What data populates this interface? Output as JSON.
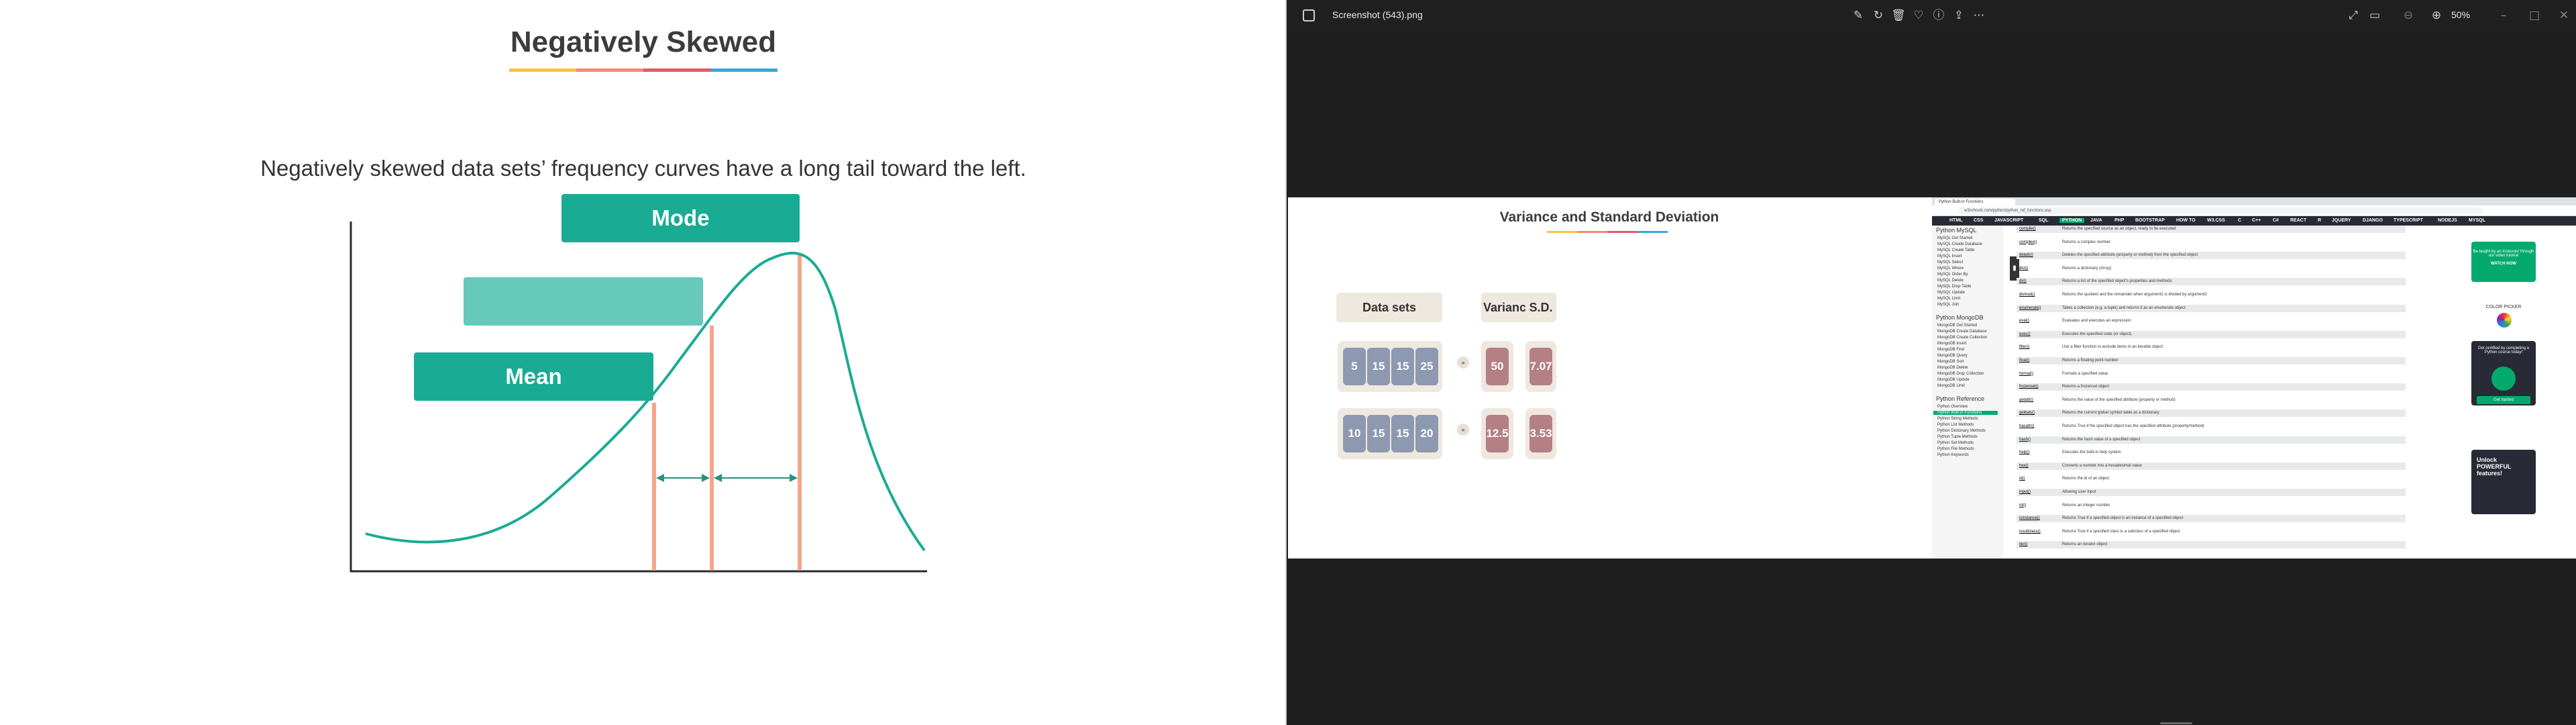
{
  "left_slide": {
    "title": "Negatively Skewed",
    "subtitle": "Negatively skewed data sets’ frequency curves have a long tail toward the left.",
    "title_bar_colors": [
      "#f6c343",
      "#f08a76",
      "#e25b6a",
      "#3aa6d6"
    ],
    "labels": {
      "mode": "Mode",
      "median": "",
      "mean": "Mean"
    },
    "colors": {
      "teal": "#1aab94",
      "teal_light": "#66c9bb",
      "salmon": "#f4a58a",
      "axis": "#2b2b2b"
    }
  },
  "viewer": {
    "filename": "Screenshot (543).png",
    "zoom": "50%",
    "toolbar_icons": [
      "edit-icon",
      "rotate-icon",
      "delete-icon",
      "favorite-icon",
      "info-icon",
      "share-icon",
      "more-icon"
    ],
    "right_icons": [
      "fullscreen-icon",
      "slideshow-icon",
      "zoom-out-icon",
      "zoom-in-icon"
    ],
    "window_controls": [
      "minimize-icon",
      "maximize-icon",
      "close-icon"
    ]
  },
  "variance_slide": {
    "title": "Variance and Standard Deviation",
    "headers": {
      "datasets": "Data sets",
      "variance": "Variance",
      "sd": "S.D."
    },
    "rows": [
      {
        "values": [
          "5",
          "15",
          "15",
          "25"
        ],
        "variance": "50",
        "sd": "7.07"
      },
      {
        "values": [
          "10",
          "15",
          "15",
          "20"
        ],
        "variance": "12.5",
        "sd": "3.53"
      }
    ],
    "arrow": "»"
  },
  "browser": {
    "tab": "Python Built-in Functions",
    "url": "w3schools.com/python/python_ref_functions.asp",
    "nav": [
      "HTML",
      "CSS",
      "JAVASCRIPT",
      "SQL",
      "PYTHON",
      "JAVA",
      "PHP",
      "BOOTSTRAP",
      "HOW TO",
      "W3.CSS",
      "C",
      "C++",
      "C#",
      "REACT",
      "R",
      "JQUERY",
      "DJANGO",
      "TYPESCRIPT",
      "NODEJS",
      "MYSQL"
    ],
    "sidebar_headings": [
      "Python MySQL",
      "Python MongoDB",
      "Python Reference"
    ],
    "mysql_items": [
      "MySQL Get Started",
      "MySQL Create Database",
      "MySQL Create Table",
      "MySQL Insert",
      "MySQL Select",
      "MySQL Where",
      "MySQL Order By",
      "MySQL Delete",
      "MySQL Drop Table",
      "MySQL Update",
      "MySQL Limit",
      "MySQL Join"
    ],
    "mongo_items": [
      "MongoDB Get Started",
      "MongoDB Create Database",
      "MongoDB Create Collection",
      "MongoDB Insert",
      "MongoDB Find",
      "MongoDB Query",
      "MongoDB Sort",
      "MongoDB Delete",
      "MongoDB Drop Collection",
      "MongoDB Update",
      "MongoDB Limit"
    ],
    "ref_items": [
      "Python Overview",
      "Python Built-in Functions",
      "Python String Methods",
      "Python List Methods",
      "Python Dictionary Methods",
      "Python Tuple Methods",
      "Python Set Methods",
      "Python File Methods",
      "Python Keywords"
    ],
    "rows": [
      [
        "compile()",
        "Returns the specified source as an object, ready to be executed"
      ],
      [
        "complex()",
        "Returns a complex number"
      ],
      [
        "delattr()",
        "Deletes the specified attribute (property or method) from the specified object"
      ],
      [
        "dict()",
        "Returns a dictionary (Array)"
      ],
      [
        "dir()",
        "Returns a list of the specified object's properties and methods"
      ],
      [
        "divmod()",
        "Returns the quotient and the remainder when argument1 is divided by argument2"
      ],
      [
        "enumerate()",
        "Takes a collection (e.g. a tuple) and returns it as an enumerate object"
      ],
      [
        "eval()",
        "Evaluates and executes an expression"
      ],
      [
        "exec()",
        "Executes the specified code (or object)"
      ],
      [
        "filter()",
        "Use a filter function to exclude items in an iterable object"
      ],
      [
        "float()",
        "Returns a floating point number"
      ],
      [
        "format()",
        "Formats a specified value"
      ],
      [
        "frozenset()",
        "Returns a frozenset object"
      ],
      [
        "getattr()",
        "Returns the value of the specified attribute (property or method)"
      ],
      [
        "globals()",
        "Returns the current global symbol table as a dictionary"
      ],
      [
        "hasattr()",
        "Returns True if the specified object has the specified attribute (property/method)"
      ],
      [
        "hash()",
        "Returns the hash value of a specified object"
      ],
      [
        "help()",
        "Executes the built-in help system"
      ],
      [
        "hex()",
        "Converts a number into a hexadecimal value"
      ],
      [
        "id()",
        "Returns the id of an object"
      ],
      [
        "input()",
        "Allowing user input"
      ],
      [
        "int()",
        "Returns an integer number"
      ],
      [
        "isinstance()",
        "Returns True if a specified object is an instance of a specified object"
      ],
      [
        "issubclass()",
        "Returns True if a specified class is a subclass of a specified object"
      ],
      [
        "iter()",
        "Returns an iterator object"
      ]
    ],
    "ads": {
      "green_text": "Be taught by an Instructor through our video tutorial",
      "green_button": "WATCH NOW",
      "color_picker": "COLOR PICKER",
      "dark_text": "Get certified by completing a Python course today!",
      "dark_button": "Get started",
      "dark2_text": "Unlock POWERFUL features!"
    }
  }
}
